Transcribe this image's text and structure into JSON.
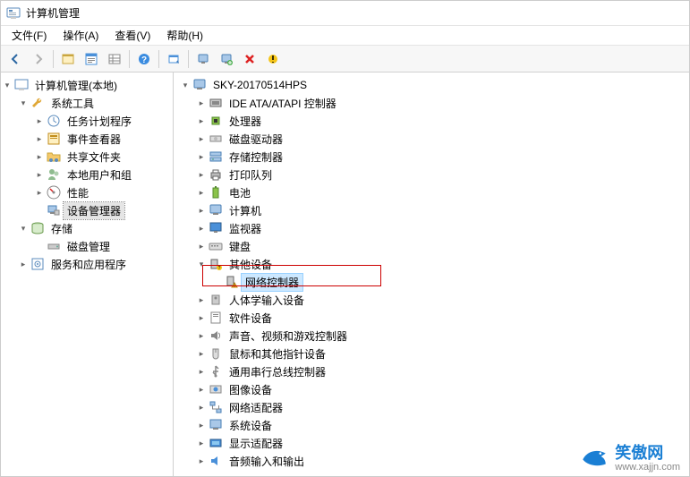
{
  "title": "计算机管理",
  "menu": {
    "file": "文件(F)",
    "action": "操作(A)",
    "view": "查看(V)",
    "help": "帮助(H)"
  },
  "left_tree": {
    "root": "计算机管理(本地)",
    "system_tools": "系统工具",
    "task_scheduler": "任务计划程序",
    "event_viewer": "事件查看器",
    "shared_folders": "共享文件夹",
    "local_users": "本地用户和组",
    "performance": "性能",
    "device_manager": "设备管理器",
    "storage": "存储",
    "disk_mgmt": "磁盘管理",
    "services_apps": "服务和应用程序"
  },
  "right_tree": {
    "root": "SKY-20170514HPS",
    "ide": "IDE ATA/ATAPI 控制器",
    "cpu": "处理器",
    "diskdrive": "磁盘驱动器",
    "storage_ctrl": "存储控制器",
    "print_queue": "打印队列",
    "battery": "电池",
    "computer": "计算机",
    "monitor": "监视器",
    "keyboard": "键盘",
    "other_devices": "其他设备",
    "net_controller": "网络控制器",
    "hid": "人体学输入设备",
    "software_dev": "软件设备",
    "sound": "声音、视频和游戏控制器",
    "mouse": "鼠标和其他指针设备",
    "usb": "通用串行总线控制器",
    "imaging": "图像设备",
    "net_adapter": "网络适配器",
    "system_dev": "系统设备",
    "display": "显示适配器",
    "audio_io": "音频输入和输出"
  },
  "watermark": {
    "text": "笑傲网",
    "url": "www.xajjn.com"
  }
}
